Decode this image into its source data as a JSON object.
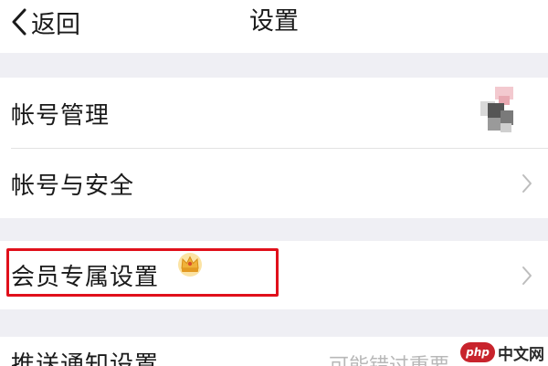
{
  "nav": {
    "back_label": "返回",
    "title": "设置"
  },
  "rows": {
    "account_management": {
      "label": "帐号管理"
    },
    "account_security": {
      "label": "帐号与安全"
    },
    "member_settings": {
      "label": "会员专属设置"
    },
    "push_settings": {
      "label": "推送通知设置",
      "hint": "可能错过重要..."
    }
  },
  "icons": {
    "back": "chevron-left-icon",
    "chevron": "chevron-right-icon",
    "crown": "crown-icon"
  },
  "colors": {
    "highlight": "#e0101b",
    "group_gap": "#efeff4",
    "crown": "#f0b23a"
  },
  "watermark": {
    "logo": "php",
    "text": "中文网"
  }
}
